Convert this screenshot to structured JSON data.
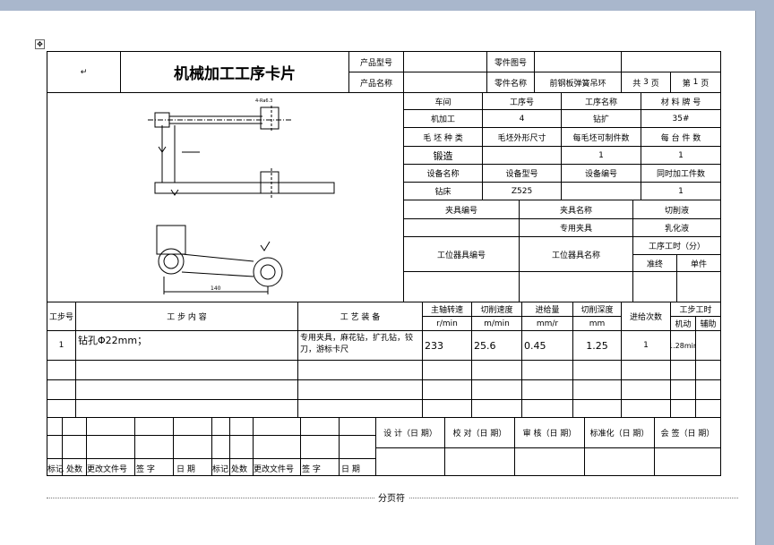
{
  "header": {
    "title": "机械加工工序卡片",
    "product_model_label": "产品型号",
    "product_name_label": "产品名称",
    "part_drawing_label": "零件图号",
    "part_name_label": "零件名称",
    "part_name_value": "前钢板弹簧吊环",
    "total_label": "共",
    "total_pages": "3",
    "page_unit": "页",
    "page_label": "第",
    "page_number": "1",
    "left_mark": "↵"
  },
  "info": {
    "workshop_label": "车间",
    "workshop_value": "机加工",
    "op_no_label": "工序号",
    "op_no_value": "4",
    "op_name_label": "工序名称",
    "op_name_value": "钻扩",
    "material_label": "材 料 牌 号",
    "material_value": "35#",
    "blank_type_label": "毛 坯 种 类",
    "blank_type_value": "锻造",
    "blank_size_label": "毛坯外形尺寸",
    "per_blank_label": "每毛坯可制件数",
    "per_blank_value": "1",
    "per_unit_label": "每 台 件 数",
    "per_unit_value": "1",
    "equip_name_label": "设备名称",
    "equip_name_value": "钻床",
    "equip_model_label": "设备型号",
    "equip_model_value": "Z525",
    "equip_no_label": "设备编号",
    "simul_label": "同时加工件数",
    "simul_value": "1",
    "fixture_no_label": "夹具编号",
    "fixture_name_label": "夹具名称",
    "coolant_label": "切削液",
    "special_fixture": "专用夹具",
    "coolant_value": "乳化液",
    "station_no_label": "工位器具编号",
    "station_name_label": "工位器具名称",
    "op_time_label": "工序工时（分）",
    "prep_label": "准终",
    "unit_label": "单件"
  },
  "drawing": {
    "dim_140": "140",
    "roughness": "4-Ra6.3"
  },
  "steps": {
    "col_step": "工步号",
    "col_content": "工 步 内 容",
    "col_equipment": "工 艺 装 备",
    "col_spindle": "主轴转速",
    "col_spindle_unit": "r/min",
    "col_speed": "切削速度",
    "col_speed_unit": "m/min",
    "col_feed": "进给量",
    "col_feed_unit": "mm/r",
    "col_depth": "切削深度",
    "col_depth_unit": "mm",
    "col_passes": "进给次数",
    "col_hours": "工步工时",
    "col_machine": "机动",
    "col_aux": "辅助",
    "row1": {
      "no": "1",
      "content": "钻孔Φ22mm；",
      "equipment": "专用夹具，麻花钻，扩孔钻，铰刀，游标卡尺",
      "spindle": "233",
      "speed": "25.6",
      "feed": "0.45",
      "depth": "1.25",
      "passes": "1",
      "machine": "1.28min"
    }
  },
  "footer": {
    "design": "设 计（日 期）",
    "check": "校 对（日 期）",
    "review": "审 核（日 期）",
    "standard": "标准化（日 期）",
    "countersign": "会 签（日 期）",
    "mark": "标记",
    "count": "处数",
    "doc_no": "更改文件号",
    "sign": "签 字",
    "date": "日 期",
    "page_break": "分页符"
  }
}
